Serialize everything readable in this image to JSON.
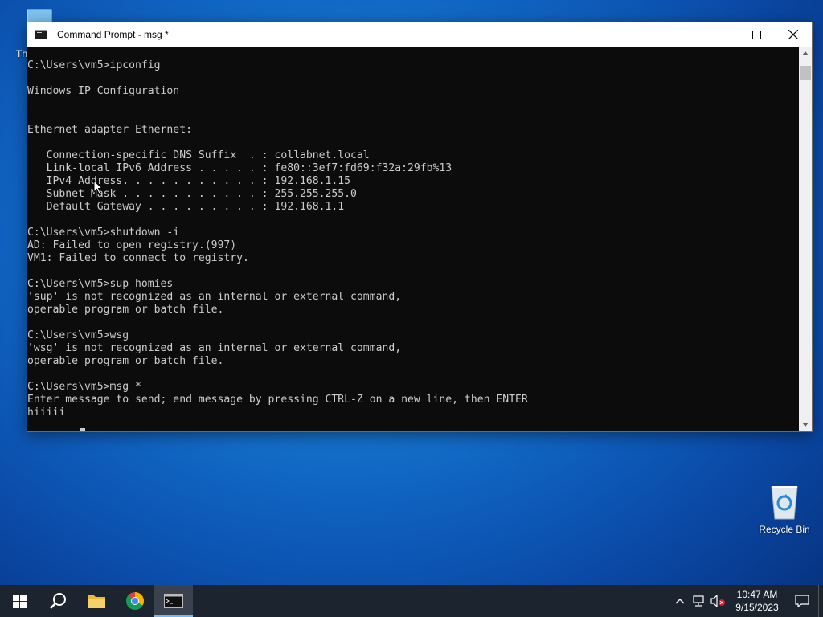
{
  "desktop": {
    "this_pc_label": "Th",
    "recycle_bin_label": "Recycle Bin"
  },
  "window": {
    "title": "Command Prompt - msg  *",
    "console_lines": [
      "C:\\Users\\vm5>ipconfig",
      "",
      "Windows IP Configuration",
      "",
      "",
      "Ethernet adapter Ethernet:",
      "",
      "   Connection-specific DNS Suffix  . : collabnet.local",
      "   Link-local IPv6 Address . . . . . : fe80::3ef7:fd69:f32a:29fb%13",
      "   IPv4 Address. . . . . . . . . . . : 192.168.1.15",
      "   Subnet Mask . . . . . . . . . . . : 255.255.255.0",
      "   Default Gateway . . . . . . . . . : 192.168.1.1",
      "",
      "C:\\Users\\vm5>shutdown -i",
      "AD: Failed to open registry.(997)",
      "VM1: Failed to connect to registry.",
      "",
      "C:\\Users\\vm5>sup homies",
      "'sup' is not recognized as an internal or external command,",
      "operable program or batch file.",
      "",
      "C:\\Users\\vm5>wsg",
      "'wsg' is not recognized as an internal or external command,",
      "operable program or batch file.",
      "",
      "C:\\Users\\vm5>msg *",
      "Enter message to send; end message by pressing CTRL-Z on a new line, then ENTER",
      "hiiiii"
    ]
  },
  "taskbar": {
    "pinned": [
      "start-icon",
      "search-icon",
      "file-explorer-icon",
      "chrome-icon",
      "command-prompt-icon"
    ],
    "clock_time": "10:47 AM",
    "clock_date": "9/15/2023"
  },
  "colors": {
    "console_bg": "#0c0c0c",
    "console_fg": "#cccccc",
    "taskbar_bg": "#1c2430",
    "accent": "#76b9ed"
  }
}
